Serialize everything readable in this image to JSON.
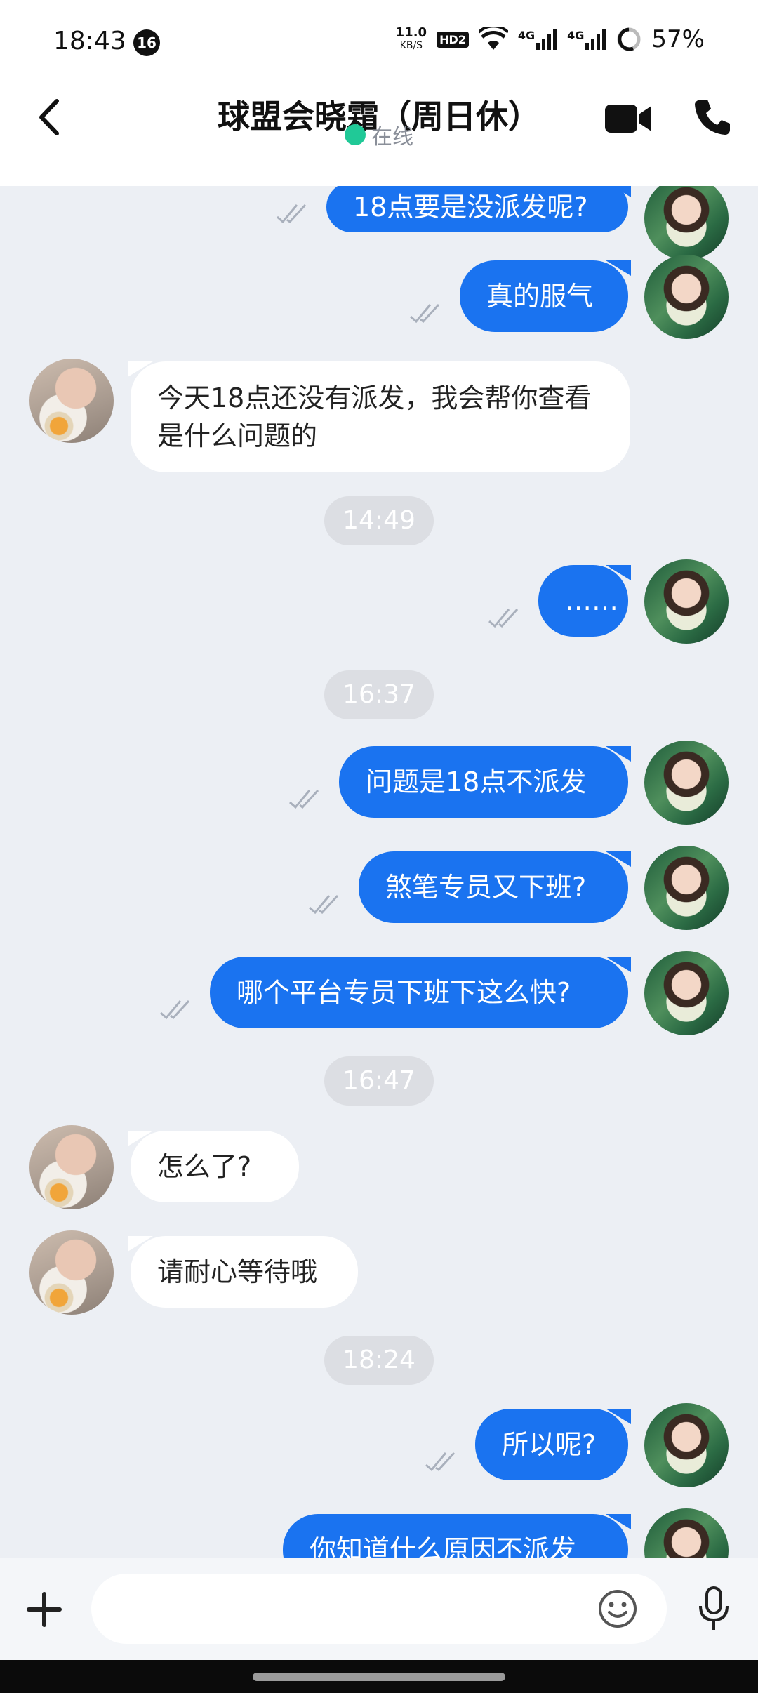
{
  "status_bar": {
    "time": "18:43",
    "notification_count": "16",
    "net_speed": "11.0",
    "net_speed_unit": "KB/S",
    "hd_badge": "HD2",
    "signal_1": "4G",
    "signal_2": "4G",
    "battery": "57%"
  },
  "header": {
    "title": "球盟会晓霜（周日休）",
    "presence": "在线",
    "icons": {
      "back": "back-arrow-icon",
      "video": "video-camera-icon",
      "call": "phone-icon"
    }
  },
  "messages": [
    {
      "sender": "me",
      "text": "18点要是没派发呢?",
      "read": true
    },
    {
      "sender": "me",
      "text": "真的服气",
      "read": true
    },
    {
      "sender": "other",
      "text": "今天18点还没有派发，我会帮你查看是什么问题的"
    },
    {
      "type": "time",
      "text": "14:49"
    },
    {
      "sender": "me",
      "text": "……",
      "read": true
    },
    {
      "type": "time",
      "text": "16:37"
    },
    {
      "sender": "me",
      "text": "问题是18点不派发",
      "read": true
    },
    {
      "sender": "me",
      "text": "煞笔专员又下班?",
      "read": true
    },
    {
      "sender": "me",
      "text": "哪个平台专员下班下这么快?",
      "read": true
    },
    {
      "type": "time",
      "text": "16:47"
    },
    {
      "sender": "other",
      "text": "怎么了?"
    },
    {
      "sender": "other",
      "text": "请耐心等待哦"
    },
    {
      "type": "time",
      "text": "18:24"
    },
    {
      "sender": "me",
      "text": "所以呢?",
      "read": true
    },
    {
      "sender": "me",
      "text": "你知道什么原因不派发",
      "read": true
    }
  ],
  "input": {
    "placeholder": "",
    "icons": {
      "plus": "plus-icon",
      "emoji": "emoji-icon",
      "mic": "microphone-icon"
    }
  },
  "colors": {
    "my_bubble": "#1a73f0",
    "other_bubble": "#ffffff",
    "chat_background": "#eceff4",
    "presence": "#20c997"
  }
}
